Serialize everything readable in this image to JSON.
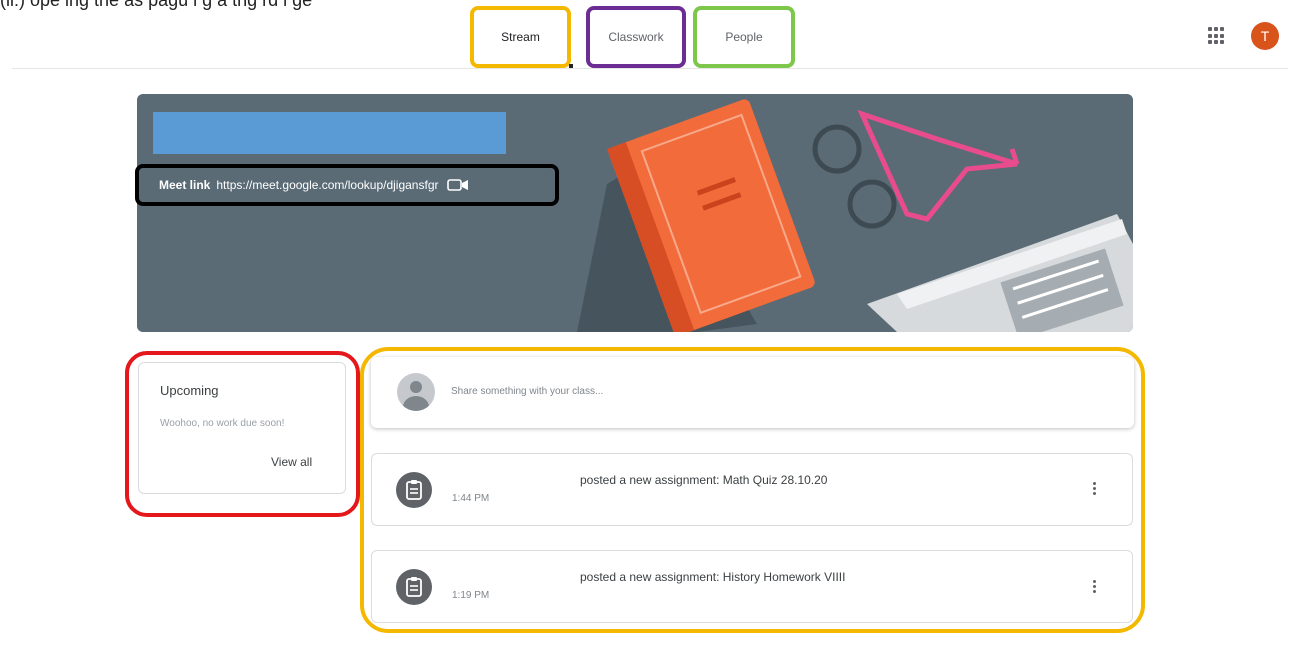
{
  "caption": {
    "text": "(ii:) ope ing the as  pagu i g  a   thg  rd i   ge"
  },
  "nav": {
    "tabs": [
      {
        "label": "Stream",
        "active": true,
        "outline_color": "#f5b800"
      },
      {
        "label": "Classwork",
        "active": false,
        "outline_color": "#6b2d93"
      },
      {
        "label": "People",
        "active": false,
        "outline_color": "#7dc84a"
      }
    ],
    "apps_icon": "apps-grid-icon",
    "account": {
      "initial": "T",
      "color": "#d9541b"
    }
  },
  "banner": {
    "meet_label": "Meet link",
    "meet_url": "https://meet.google.com/lookup/djigansfgr",
    "meet_box_color": "#000000",
    "title_bar_color": "#5b9bd5",
    "background_color": "#5a6b76"
  },
  "upcoming": {
    "title": "Upcoming",
    "subtitle": "Woohoo, no work due soon!",
    "view_all": "View all",
    "outline_color": "#e4171b"
  },
  "stream": {
    "share_placeholder": "Share something with your class...",
    "outline_color": "#f5b800",
    "posts": [
      {
        "title": "posted a new assignment: Math Quiz 28.10.20",
        "time": "1:44 PM"
      },
      {
        "title": "posted a new assignment: History Homework VIIII",
        "time": "1:19 PM"
      }
    ]
  }
}
